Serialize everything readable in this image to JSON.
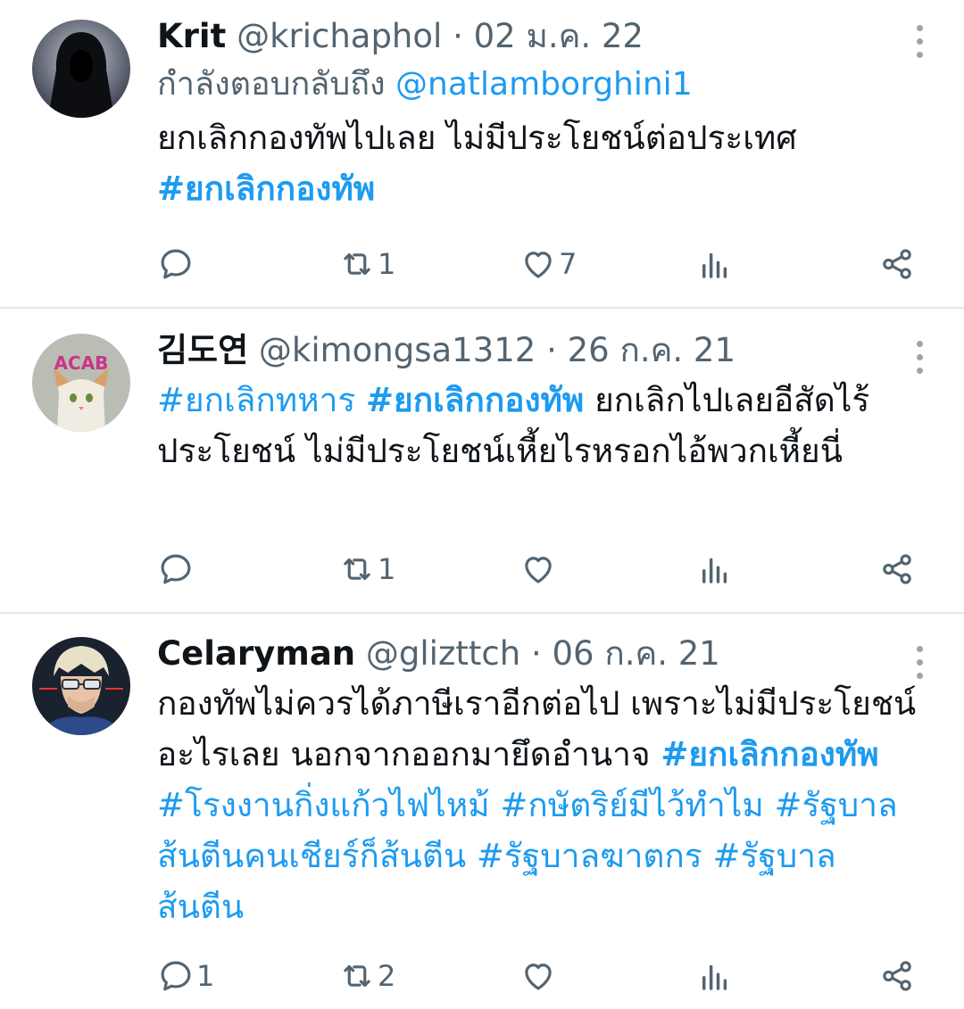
{
  "tweets": [
    {
      "display_name": "Krit",
      "handle": "@krichaphol",
      "date": "02 ม.ค. 22",
      "reply_prefix": "กำลังตอบกลับถึง ",
      "reply_to": "@natlamborghini1",
      "text": "ยกเลิกกองทัพไปเลย ไม่มีประโยชน์ต่อประเทศ",
      "tags": [
        "#ยกเลิกกองทัพ"
      ],
      "replies": "",
      "retweets": "1",
      "likes": "7",
      "avatar_icon": "hooded-figure-avatar"
    },
    {
      "display_name": "김도연",
      "handle": "@kimongsa1312",
      "date": "26 ก.ค. 21",
      "tag_a": "#ยกเลิกทหาร",
      "tag_b": "#ยกเลิกกองทัพ",
      "text": "ยกเลิกไปเลยอีสัดไร้ประโยชน์ ไม่มีประโยชน์เหี้ยไรหรอกไอ้พวกเหี้ยนี่",
      "replies": "",
      "retweets": "1",
      "likes": "",
      "avatar_icon": "cat-anarchy-avatar",
      "avatar_text": "ACAB"
    },
    {
      "display_name": "Celaryman",
      "handle": "@glizttch",
      "date": "06 ก.ค. 21",
      "text": "กองทัพไม่ควรได้ภาษีเราอีกต่อไป เพราะไม่มีประโยชน์อะไรเลย นอกจากออกมายึดอำนาจ",
      "tag_bold": "#ยกเลิกกองทัพ",
      "tags_rest": "#โรงงานกิ่งแก้วไฟไหม้ #กษัตริย์มีไว้ทำไม #รัฐบาลส้นตีนคนเชียร์ก็ส้นตีน #รัฐบาลฆาตกร #รัฐบาลส้นตีน",
      "replies": "1",
      "retweets": "2",
      "likes": "",
      "avatar_icon": "anime-character-avatar"
    }
  ],
  "colors": {
    "link": "#1d9bf0",
    "muted": "#536471",
    "divider": "#e4e8eb"
  },
  "icons": [
    "reply-icon",
    "retweet-icon",
    "like-icon",
    "views-icon",
    "share-icon",
    "more-icon"
  ]
}
